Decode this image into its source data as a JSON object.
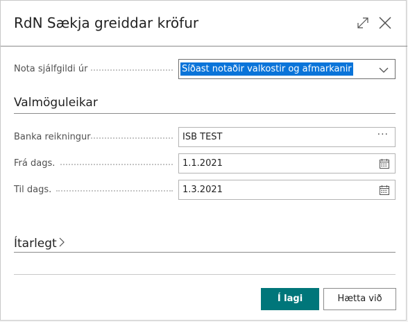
{
  "dialog": {
    "title": "RdN Sækja greiddar kröfur",
    "expand_icon": "expand-icon",
    "close_icon": "close-icon"
  },
  "saved_values": {
    "label": "Nota sjálfgildi úr",
    "selected": "Síðast notaðir valkostir og afmarkanir",
    "chevron_icon": "chevron-down-icon"
  },
  "options_section": {
    "title": "Valmöguleikar",
    "fields": [
      {
        "label": "Banka reikningur",
        "value": "ISB TEST",
        "trail": "···"
      },
      {
        "label": "Frá dags.",
        "value": "1.1.2021",
        "icon": "calendar-icon"
      },
      {
        "label": "Til dags.",
        "value": "1.3.2021",
        "icon": "calendar-icon"
      }
    ]
  },
  "details_section": {
    "title": "Ítarlegt",
    "chevron_icon": "chevron-right-icon"
  },
  "footer": {
    "ok_label": "Í lagi",
    "cancel_label": "Hætta við"
  },
  "colors": {
    "accent": "#00767a",
    "selection": "#0a74d9"
  }
}
